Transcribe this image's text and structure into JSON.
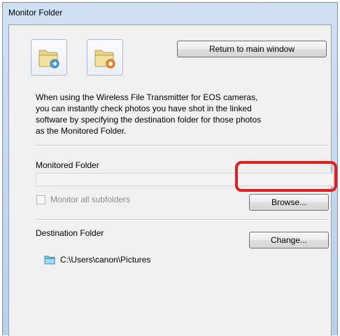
{
  "window": {
    "title": "Monitor Folder"
  },
  "toolbar": {
    "start_monitor_icon": "folder-with-blue-arrow-icon",
    "stop_monitor_icon": "folder-with-orange-stop-icon",
    "return_button": "Return to main window"
  },
  "description": {
    "lines": [
      "When using the Wireless File Transmitter for EOS cameras,",
      "you can instantly check photos you have shot in the linked",
      "software by specifying the destination folder for those photos",
      "as the Monitored Folder."
    ]
  },
  "monitored": {
    "label": "Monitored Folder",
    "path_value": "",
    "subfolders_label": "Monitor all subfolders",
    "subfolders_checked": false,
    "browse_button": "Browse...",
    "highlight_color": "#e0201e"
  },
  "destination": {
    "label": "Destination Folder",
    "change_button": "Change...",
    "path": "C:\\Users\\canon\\Pictures",
    "folder_icon": "folder-icon"
  }
}
